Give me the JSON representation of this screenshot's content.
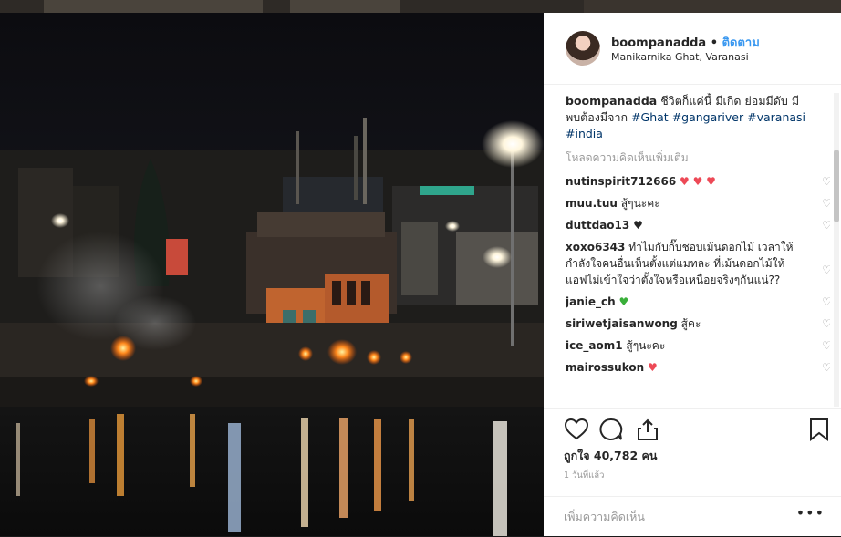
{
  "post": {
    "username": "boompanadda",
    "dot": "•",
    "follow_label": "ติดตาม",
    "location": "Manikarnika Ghat, Varanasi"
  },
  "caption": {
    "username": "boompanadda",
    "text": "ชีวิตก็แค่นี้ มีเกิด ย่อมมีดับ มีพบต้องมีจาก",
    "hashtags": [
      "#Ghat",
      "#gangariver",
      "#varanasi",
      "#india"
    ]
  },
  "load_more_label": "โหลดความคิดเห็นเพิ่มเติม",
  "comments": [
    {
      "user": "nutinspirit712666",
      "text": "",
      "emoji": "♥ ♥ ♥",
      "emoji_color": "#ed4956"
    },
    {
      "user": "muu.tuu",
      "text": "สู้ๆนะคะ",
      "emoji": "",
      "emoji_color": ""
    },
    {
      "user": "duttdao13",
      "text": "",
      "emoji": "♥",
      "emoji_color": "#262626"
    },
    {
      "user": "xoxo6343",
      "text": "ทำไมกับกิ๊บชอบเม้นดอกไม้ เวลาให้กำลังใจคนอื่นเห็นตั้งแต่แมทละ ที่เม้นดอกไม้ให้แอฟไม่เข้าใจว่าตั้งใจหรือเหนื่อยจริงๆกันแน่??",
      "emoji": "",
      "emoji_color": ""
    },
    {
      "user": "janie_ch",
      "text": "",
      "emoji": "♥",
      "emoji_color": "#3aaf3a"
    },
    {
      "user": "siriwetjaisanwong",
      "text": "สู้คะ",
      "emoji": "",
      "emoji_color": ""
    },
    {
      "user": "ice_aom1",
      "text": "สู้ๆนะคะ",
      "emoji": "",
      "emoji_color": ""
    },
    {
      "user": "mairossukon",
      "text": "",
      "emoji": "♥",
      "emoji_color": "#ed4956"
    }
  ],
  "like_icon": "heart-outline-icon",
  "likes_label": "ถูกใจ 40,782 คน",
  "time_label": "1 วันที่แล้ว",
  "add_comment_placeholder": "เพิ่มความคิดเห็น",
  "more_label": "•••",
  "colors": {
    "link": "#3897f0",
    "hashtag": "#003569",
    "heart": "#ed4956",
    "muted": "#999999"
  }
}
